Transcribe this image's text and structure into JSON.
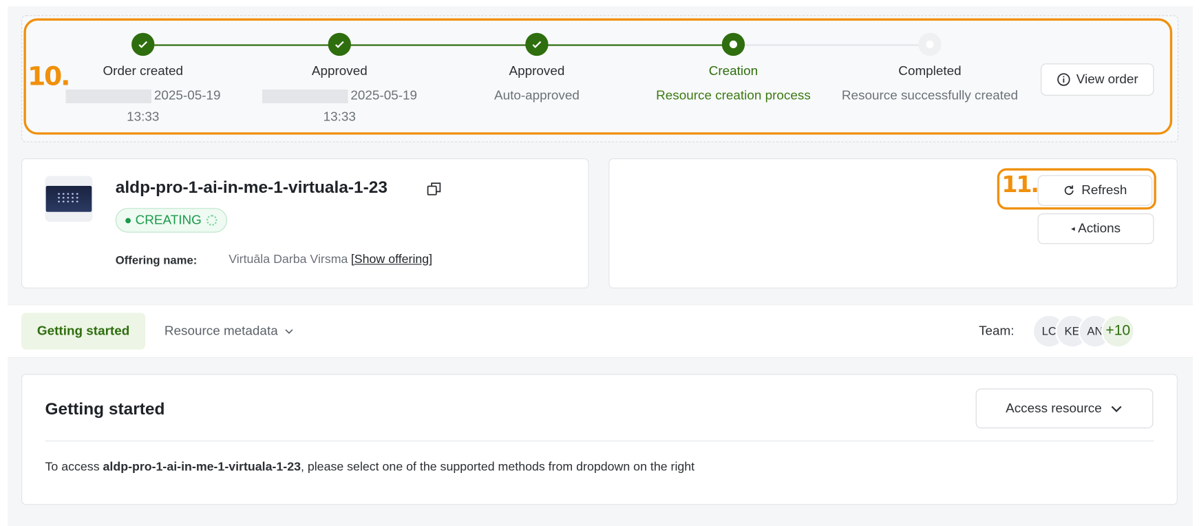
{
  "annotations": {
    "stepper_label": "10.",
    "refresh_label": "11."
  },
  "stepper": {
    "steps": [
      {
        "title": "Order created",
        "sub": "2025-05-19",
        "sub2": "13:33",
        "state": "done"
      },
      {
        "title": "Approved",
        "sub": "2025-05-19",
        "sub2": "13:33",
        "state": "done"
      },
      {
        "title": "Approved",
        "sub": "Auto-approved",
        "state": "done"
      },
      {
        "title": "Creation",
        "sub": "Resource creation process",
        "state": "current"
      },
      {
        "title": "Completed",
        "sub": "Resource successfully created",
        "state": "pending"
      }
    ],
    "view_order_label": "View order"
  },
  "resource": {
    "name": "aldp-pro-1-ai-in-me-1-virtuala-1-23",
    "status": "CREATING",
    "offering_label": "Offering name:",
    "offering_value": "Virtuāla Darba Virsma",
    "offering_link": "[Show offering]"
  },
  "actions": {
    "refresh_label": "Refresh",
    "actions_label": "Actions"
  },
  "tabs": {
    "active": "Getting started",
    "metadata": "Resource metadata"
  },
  "team": {
    "label": "Team:",
    "avatars": [
      "LC",
      "KE",
      "AN"
    ],
    "more": "+10"
  },
  "getting_started": {
    "title": "Getting started",
    "access_label": "Access resource",
    "text_prefix": "To access ",
    "text_bold": "aldp-pro-1-ai-in-me-1-virtuala-1-23",
    "text_suffix": ", please select one of the supported methods from dropdown on the right"
  },
  "colors": {
    "accent_green": "#2e6e0e",
    "annotation_orange": "#f0900c",
    "status_green": "#1a9a4a"
  }
}
